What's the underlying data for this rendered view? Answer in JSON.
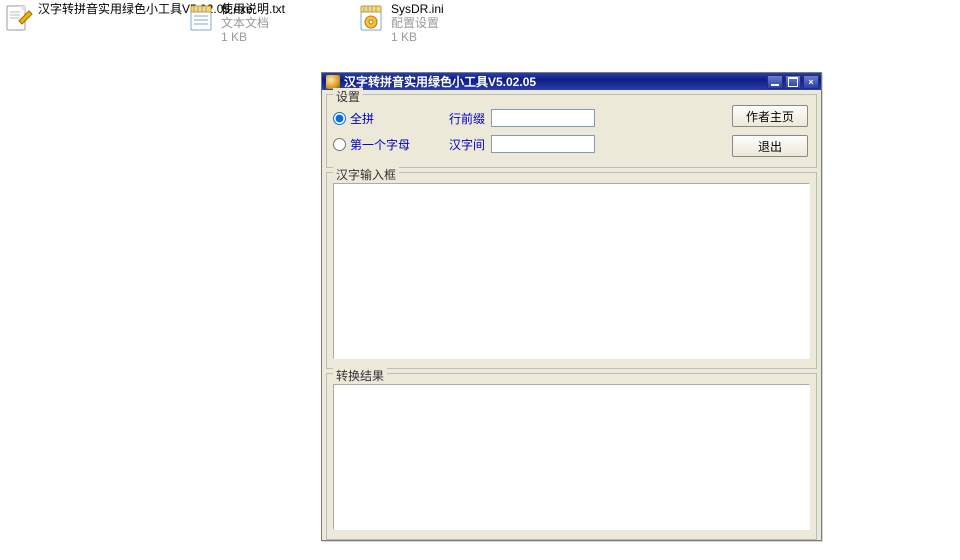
{
  "desktop": {
    "icons": [
      {
        "name": "汉字转拼音实用绿色小工具V5.02.05.exe",
        "sub1": "",
        "sub2": ""
      },
      {
        "name": "使用说明.txt",
        "sub1": "文本文档",
        "sub2": "1 KB"
      },
      {
        "name": "SysDR.ini",
        "sub1": "配置设置",
        "sub2": "1 KB"
      }
    ]
  },
  "window": {
    "title": "汉字转拼音实用绿色小工具V5.02.05",
    "settings": {
      "legend": "设置",
      "radio_full": "全拼",
      "radio_first": "第一个字母",
      "radio_selected": "full",
      "prefix_label": "行前缀",
      "prefix_value": "",
      "sep_label": "汉字间",
      "sep_value": "",
      "btn_author": "作者主页",
      "btn_exit": "退出"
    },
    "input_box": {
      "legend": "汉字输入框",
      "value": ""
    },
    "output_box": {
      "legend": "转换结果",
      "value": ""
    }
  }
}
